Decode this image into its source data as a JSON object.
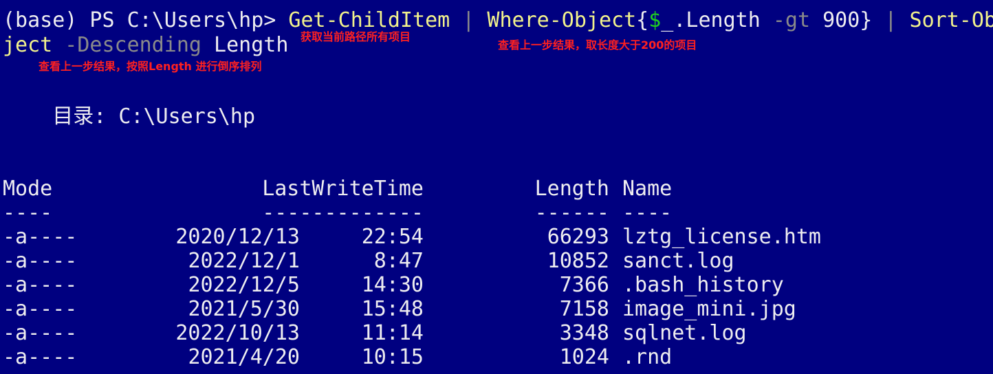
{
  "terminal": {
    "prompt": "(base) PS C:\\Users\\hp> ",
    "cmd": {
      "get_child": "Get-ChildItem",
      "pipe1": " | ",
      "where": "Where-Object",
      "brace_open": "{",
      "var_dollar": "$",
      "var_rest": "_.Length ",
      "op": "-gt",
      "space": " ",
      "num": "900",
      "brace_close": "}",
      "pipe2": " | ",
      "sort_part1": "Sort-Ob",
      "sort_part2": "ject",
      "param": " -Descending",
      "param_val": " Length"
    },
    "annotations": {
      "get_all": "获取当前路径所有项目",
      "filter": "查看上一步结果，取长度大于200的项目",
      "sort": "查看上一步结果，按照Length 进行倒序排列"
    },
    "directory_line": "    目录: C:\\Users\\hp",
    "headers": {
      "mode": "Mode",
      "lastwrite": "LastWriteTime",
      "length": "Length",
      "name": "Name"
    },
    "underlines": {
      "mode": "----",
      "lastwrite": "-------------",
      "length": "------",
      "name": "----"
    },
    "rows": [
      {
        "mode": "-a----",
        "date": "2020/12/13",
        "time": "22:54",
        "length": "66293",
        "name": "lztg_license.htm"
      },
      {
        "mode": "-a----",
        "date": "2022/12/1",
        "time": "8:47",
        "length": "10852",
        "name": "sanct.log"
      },
      {
        "mode": "-a----",
        "date": "2022/12/5",
        "time": "14:30",
        "length": "7366",
        "name": ".bash_history"
      },
      {
        "mode": "-a----",
        "date": "2021/5/30",
        "time": "15:48",
        "length": "7158",
        "name": "image_mini.jpg"
      },
      {
        "mode": "-a----",
        "date": "2022/10/13",
        "time": "11:14",
        "length": "3348",
        "name": "sqlnet.log"
      },
      {
        "mode": "-a----",
        "date": "2021/4/20",
        "time": "10:15",
        "length": "1024",
        "name": ".rnd"
      }
    ]
  },
  "colors": {
    "background": "#000080",
    "foreground": "#eeedf0",
    "parameter_gray": "#8a8a8a",
    "variable_green": "#1fd11f",
    "command_yellow": "#f2f28c",
    "annotation_red": "#ff2020"
  }
}
